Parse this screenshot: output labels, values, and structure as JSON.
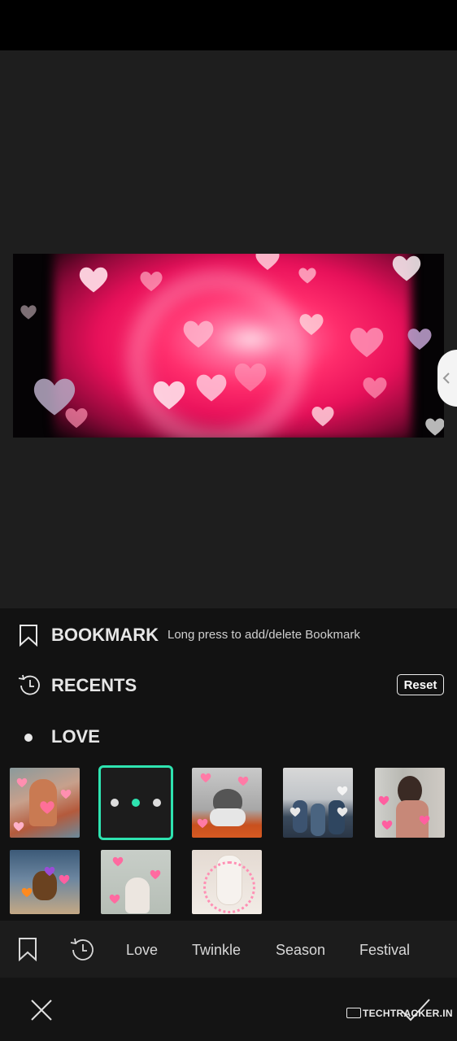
{
  "panel": {
    "bookmark": {
      "title": "BOOKMARK",
      "hint": "Long press to add/delete Bookmark"
    },
    "recents": {
      "title": "RECENTS",
      "reset_label": "Reset"
    },
    "love": {
      "title": "LOVE"
    }
  },
  "tabs": [
    "Love",
    "Twinkle",
    "Season",
    "Festival"
  ],
  "watermark": "TECHTRACKER.IN",
  "colors": {
    "selection_border": "#2ee3b0",
    "selected_dot": "#2ee3b0",
    "panel_bg": "#121212"
  }
}
